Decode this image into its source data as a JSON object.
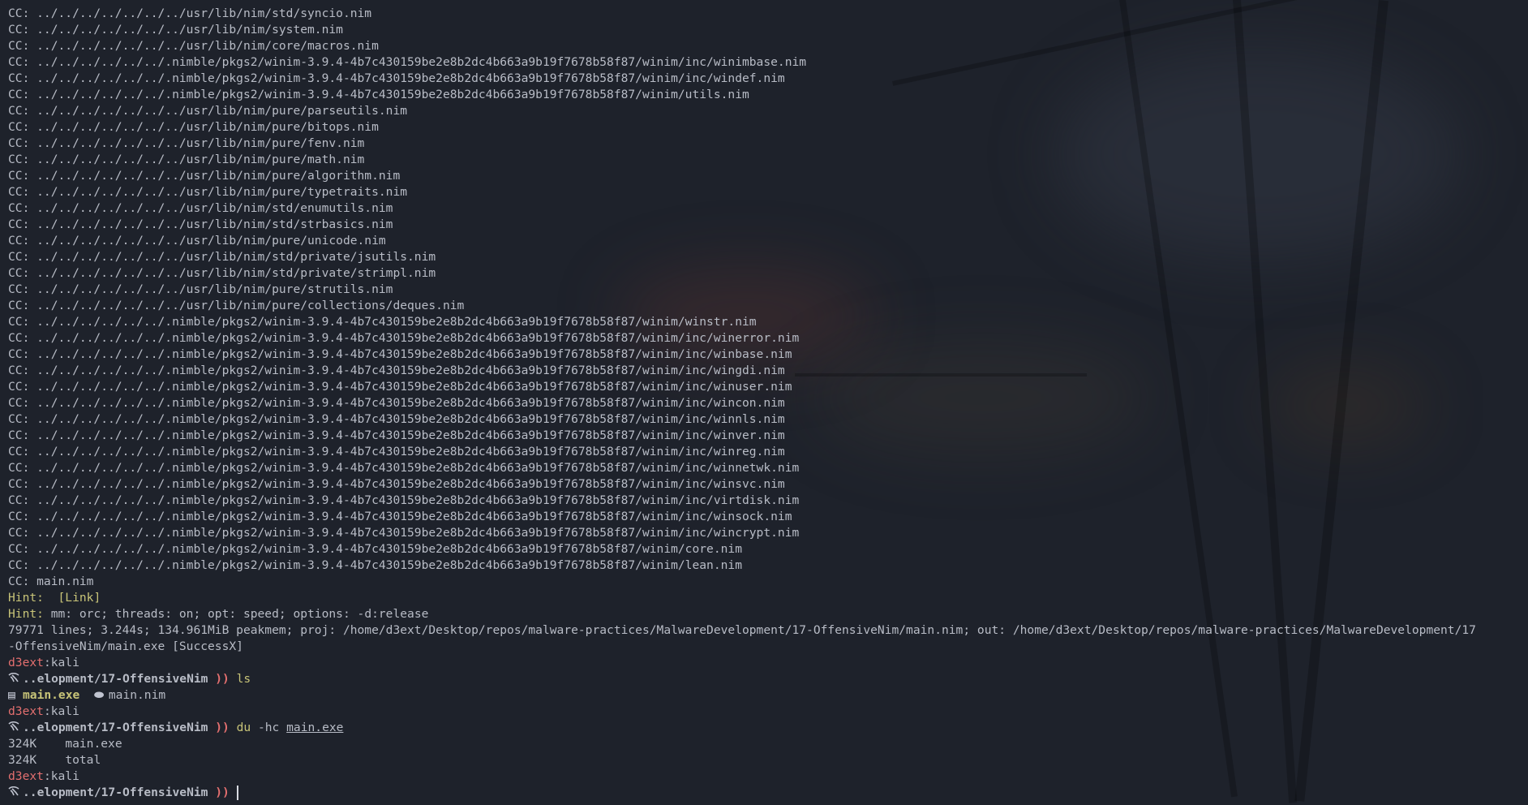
{
  "build_log": [
    "CC: ../../../../../../../usr/lib/nim/std/syncio.nim",
    "CC: ../../../../../../../usr/lib/nim/system.nim",
    "CC: ../../../../../../../usr/lib/nim/core/macros.nim",
    "CC: ../../../../../../.nimble/pkgs2/winim-3.9.4-4b7c430159be2e8b2dc4b663a9b19f7678b58f87/winim/inc/winimbase.nim",
    "CC: ../../../../../../.nimble/pkgs2/winim-3.9.4-4b7c430159be2e8b2dc4b663a9b19f7678b58f87/winim/inc/windef.nim",
    "CC: ../../../../../../.nimble/pkgs2/winim-3.9.4-4b7c430159be2e8b2dc4b663a9b19f7678b58f87/winim/utils.nim",
    "CC: ../../../../../../../usr/lib/nim/pure/parseutils.nim",
    "CC: ../../../../../../../usr/lib/nim/pure/bitops.nim",
    "CC: ../../../../../../../usr/lib/nim/pure/fenv.nim",
    "CC: ../../../../../../../usr/lib/nim/pure/math.nim",
    "CC: ../../../../../../../usr/lib/nim/pure/algorithm.nim",
    "CC: ../../../../../../../usr/lib/nim/pure/typetraits.nim",
    "CC: ../../../../../../../usr/lib/nim/std/enumutils.nim",
    "CC: ../../../../../../../usr/lib/nim/std/strbasics.nim",
    "CC: ../../../../../../../usr/lib/nim/pure/unicode.nim",
    "CC: ../../../../../../../usr/lib/nim/std/private/jsutils.nim",
    "CC: ../../../../../../../usr/lib/nim/std/private/strimpl.nim",
    "CC: ../../../../../../../usr/lib/nim/pure/strutils.nim",
    "CC: ../../../../../../../usr/lib/nim/pure/collections/deques.nim",
    "CC: ../../../../../../.nimble/pkgs2/winim-3.9.4-4b7c430159be2e8b2dc4b663a9b19f7678b58f87/winim/winstr.nim",
    "CC: ../../../../../../.nimble/pkgs2/winim-3.9.4-4b7c430159be2e8b2dc4b663a9b19f7678b58f87/winim/inc/winerror.nim",
    "CC: ../../../../../../.nimble/pkgs2/winim-3.9.4-4b7c430159be2e8b2dc4b663a9b19f7678b58f87/winim/inc/winbase.nim",
    "CC: ../../../../../../.nimble/pkgs2/winim-3.9.4-4b7c430159be2e8b2dc4b663a9b19f7678b58f87/winim/inc/wingdi.nim",
    "CC: ../../../../../../.nimble/pkgs2/winim-3.9.4-4b7c430159be2e8b2dc4b663a9b19f7678b58f87/winim/inc/winuser.nim",
    "CC: ../../../../../../.nimble/pkgs2/winim-3.9.4-4b7c430159be2e8b2dc4b663a9b19f7678b58f87/winim/inc/wincon.nim",
    "CC: ../../../../../../.nimble/pkgs2/winim-3.9.4-4b7c430159be2e8b2dc4b663a9b19f7678b58f87/winim/inc/winnls.nim",
    "CC: ../../../../../../.nimble/pkgs2/winim-3.9.4-4b7c430159be2e8b2dc4b663a9b19f7678b58f87/winim/inc/winver.nim",
    "CC: ../../../../../../.nimble/pkgs2/winim-3.9.4-4b7c430159be2e8b2dc4b663a9b19f7678b58f87/winim/inc/winreg.nim",
    "CC: ../../../../../../.nimble/pkgs2/winim-3.9.4-4b7c430159be2e8b2dc4b663a9b19f7678b58f87/winim/inc/winnetwk.nim",
    "CC: ../../../../../../.nimble/pkgs2/winim-3.9.4-4b7c430159be2e8b2dc4b663a9b19f7678b58f87/winim/inc/winsvc.nim",
    "CC: ../../../../../../.nimble/pkgs2/winim-3.9.4-4b7c430159be2e8b2dc4b663a9b19f7678b58f87/winim/inc/virtdisk.nim",
    "CC: ../../../../../../.nimble/pkgs2/winim-3.9.4-4b7c430159be2e8b2dc4b663a9b19f7678b58f87/winim/inc/winsock.nim",
    "CC: ../../../../../../.nimble/pkgs2/winim-3.9.4-4b7c430159be2e8b2dc4b663a9b19f7678b58f87/winim/inc/wincrypt.nim",
    "CC: ../../../../../../.nimble/pkgs2/winim-3.9.4-4b7c430159be2e8b2dc4b663a9b19f7678b58f87/winim/core.nim",
    "CC: ../../../../../../.nimble/pkgs2/winim-3.9.4-4b7c430159be2e8b2dc4b663a9b19f7678b58f87/winim/lean.nim",
    "CC: main.nim"
  ],
  "hints": {
    "hint1_label": "Hint:",
    "hint1_text": "  [Link]",
    "hint2_label": "Hint:",
    "hint2_text": " mm: orc; threads: on; opt: speed; options: -d:release"
  },
  "summary": {
    "line1": "79771 lines; 3.244s; 134.961MiB peakmem; proj: /home/d3ext/Desktop/repos/malware-practices/MalwareDevelopment/17-OffensiveNim/main.nim; out: /home/d3ext/Desktop/repos/malware-practices/MalwareDevelopment/17",
    "line2": "-OffensiveNim/main.exe [SuccessX]"
  },
  "prompt": {
    "user": "d3ext",
    "sep": ":",
    "host": "kali",
    "icon": "kali-dragon-icon",
    "dir": "..elopment/17-OffensiveNim",
    "arrow": "))"
  },
  "session": {
    "cmd1": "ls",
    "ls_output": {
      "exe_icon": "▤",
      "exe_name": "main.exe",
      "nim_icon": "⬬",
      "nim_name": "main.nim"
    },
    "cmd2_name": "du",
    "cmd2_flags": " -hc ",
    "cmd2_arg": "main.exe",
    "du_output": [
      {
        "size": "324K",
        "name": "main.exe"
      },
      {
        "size": "324K",
        "name": "total"
      }
    ]
  },
  "colors": {
    "background": "#1e222b",
    "text": "#b8bcc6",
    "user": "#e36f6f",
    "hint": "#c8c478",
    "command": "#c8c478"
  }
}
